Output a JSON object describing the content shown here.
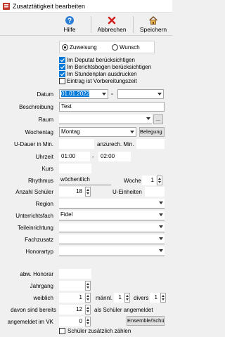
{
  "window": {
    "title": "Zusatztätigkeit bearbeiten"
  },
  "toolbar": {
    "help": "Hilfe",
    "cancel": "Abbrechen",
    "save": "Speichern"
  },
  "mode": {
    "option1": "Zuweisung",
    "option2": "Wunsch"
  },
  "checks": {
    "deputat": "Im Deputat berücksichtigen",
    "bericht": "Im Berichtsbogen berücksichtigen",
    "stundenplan": "Im Stundenplan ausdrucken",
    "vorbereitung": "Eintrag ist Vorbereitungszeit"
  },
  "form": {
    "datum_label": "Datum",
    "datum_value": "01.01.2022",
    "datum_sep": "-",
    "beschreibung_label": "Beschreibung",
    "beschreibung_value": "Test",
    "raum_label": "Raum",
    "raum_btn": "...",
    "wochentag_label": "Wochentag",
    "wochentag_value": "Montag",
    "belegung_btn": "Belegung suchen",
    "udauer_label": "U-Dauer in Min.",
    "anzurech_label": "anzurech. Min.",
    "uhrzeit_label": "Uhrzeit",
    "uhrzeit_von": "01:00",
    "uhrzeit_sep": "-",
    "uhrzeit_bis": "02:00",
    "kurs_label": "Kurs",
    "rhythmus_label": "Rhythmus",
    "rhythmus_value": "wöchentlich",
    "woche_label": "Woche",
    "woche_value": "1",
    "anzahl_label": "Anzahl Schüler",
    "anzahl_value": "18",
    "ueinheiten_label": "U-Einheiten",
    "region_label": "Region",
    "fach_label": "Unterrichtsfach",
    "fach_value": "Fidel",
    "teil_label": "Teileinrichtung",
    "fachzusatz_label": "Fachzusatz",
    "honorartyp_label": "Honorartyp",
    "abwhonorar_label": "abw. Honorar",
    "jahrgang_label": "Jahrgang",
    "weiblich_label": "weiblich",
    "weiblich_value": "1",
    "maennl_label": "männl.",
    "maennl_value": "1",
    "divers_label": "divers",
    "divers_value": "1",
    "davon_label": "davon sind bereits",
    "davon_value": "12",
    "als_label": "als Schüler angemeldet",
    "angemeldet_label": "angemeldet im VK",
    "vk_value": "0",
    "ensemble_btn": "Ensemble/Schüler",
    "zusaetzlich_label": "Schüler zusätzlich zählen"
  }
}
